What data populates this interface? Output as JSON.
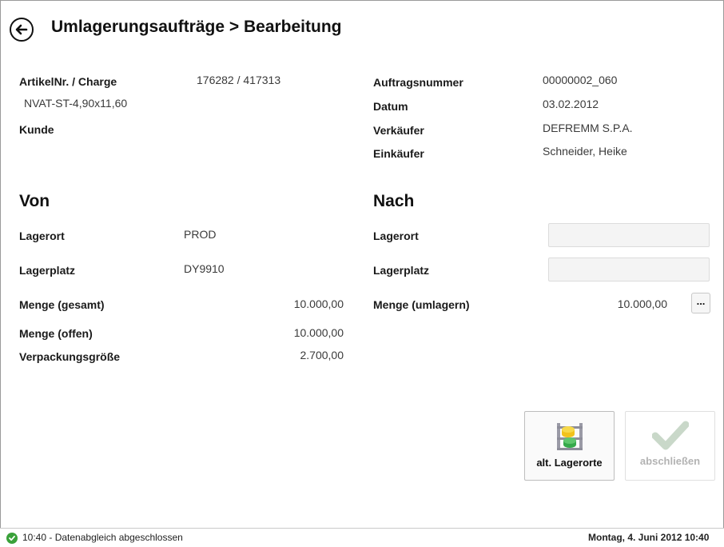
{
  "header": {
    "title": "Umlagerungsaufträge > Bearbeitung"
  },
  "article": {
    "label": "ArtikelNr. / Charge",
    "value": "176282 / 417313",
    "description": "NVAT-ST-4,90x11,60",
    "customer_label": "Kunde",
    "customer_value": ""
  },
  "order": {
    "number_label": "Auftragsnummer",
    "number_value": "00000002_060",
    "date_label": "Datum",
    "date_value": "03.02.2012",
    "seller_label": "Verkäufer",
    "seller_value": "DEFREMM S.P.A.",
    "buyer_label": "Einkäufer",
    "buyer_value": "Schneider, Heike"
  },
  "from": {
    "heading": "Von",
    "location_label": "Lagerort",
    "location_value": "PROD",
    "place_label": "Lagerplatz",
    "place_value": "DY9910",
    "qty_total_label": "Menge (gesamt)",
    "qty_total_value": "10.000,00",
    "qty_open_label": "Menge (offen)",
    "qty_open_value": "10.000,00",
    "pack_label": "Verpackungsgröße",
    "pack_value": "2.700,00"
  },
  "to": {
    "heading": "Nach",
    "location_label": "Lagerort",
    "location_value": "",
    "place_label": "Lagerplatz",
    "place_value": "",
    "qty_label": "Menge (umlagern)",
    "qty_value": "10.000,00",
    "browse_label": "..."
  },
  "actions": {
    "alt_locations_label": "alt. Lagerorte",
    "finish_label": "abschließen"
  },
  "status": {
    "message": "10:40 - Datenabgleich abgeschlossen",
    "datetime": "Montag, 4. Juni 2012 10:40",
    "ok_color": "#3aa13a"
  }
}
